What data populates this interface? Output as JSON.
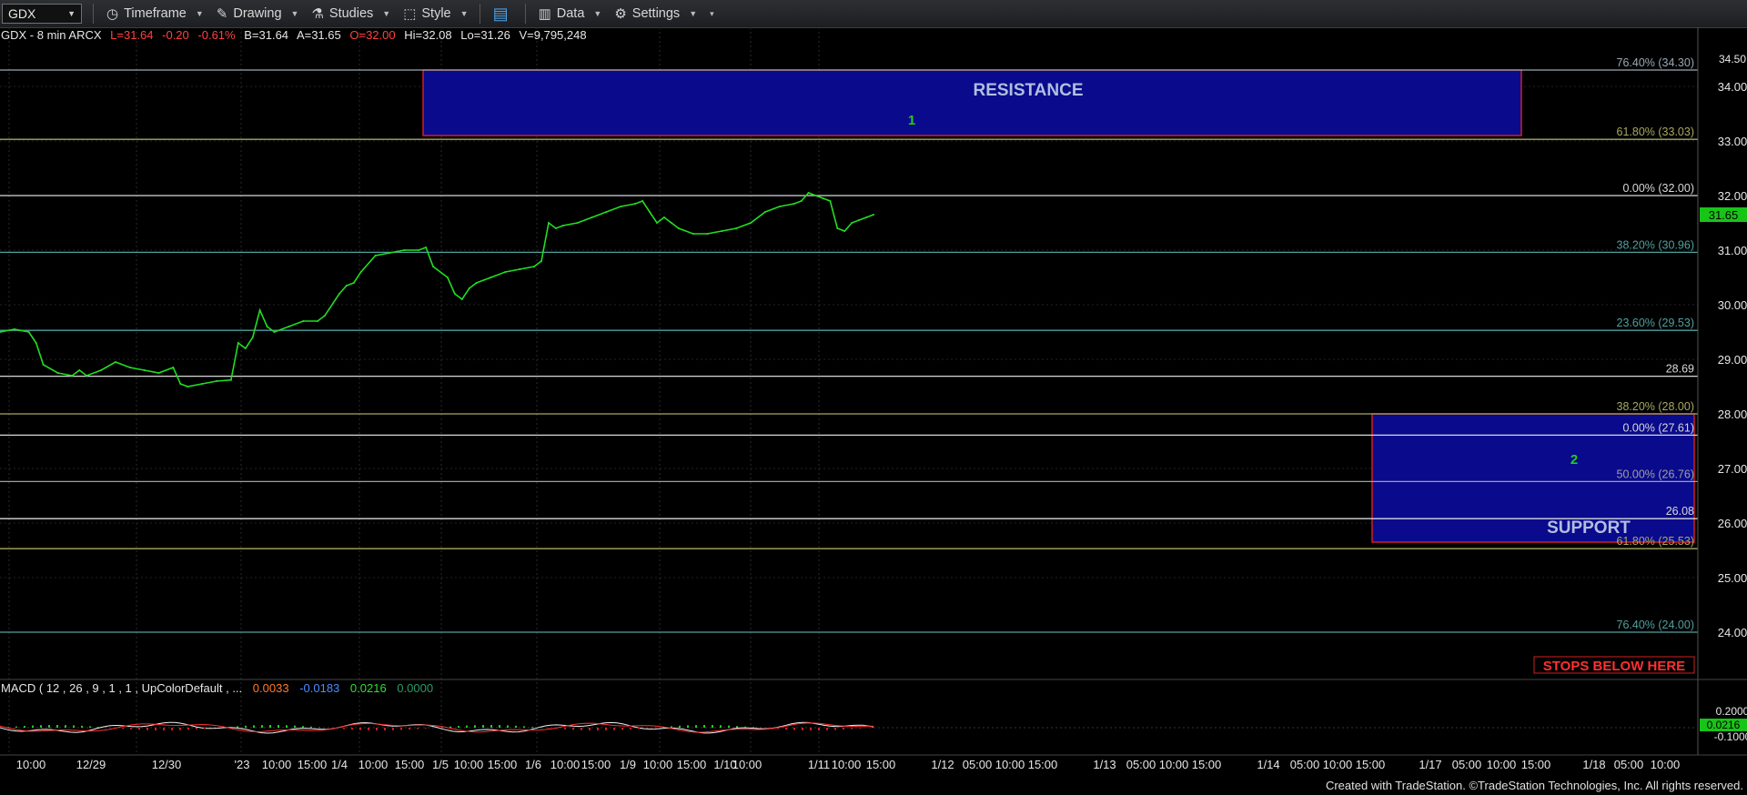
{
  "toolbar": {
    "symbol": "GDX",
    "timeframe": "Timeframe",
    "drawing": "Drawing",
    "studies": "Studies",
    "style": "Style",
    "data": "Data",
    "settings": "Settings"
  },
  "header": {
    "symbol": "GDX - 8 min  ARCX",
    "last": "L=31.64",
    "change": "-0.20",
    "pct": "-0.61%",
    "bid": "B=31.64",
    "ask": "A=31.65",
    "open": "O=32.00",
    "high": "Hi=32.08",
    "low": "Lo=31.26",
    "volume": "V=9,795,248"
  },
  "macd_header": {
    "label": "MACD ( 12 , 26 , 9 , 1 , 1 , UpColorDefault , ...",
    "v1": "0.0033",
    "v2": "-0.0183",
    "v3": "0.0216",
    "v4": "0.0000"
  },
  "chart_data": {
    "type": "line",
    "title": "",
    "ylim": [
      23.0,
      35.0
    ],
    "y_ticks": [
      "34.00",
      "33.00",
      "32.00",
      "31.00",
      "30.00",
      "29.00",
      "28.00",
      "27.00",
      "26.00",
      "25.00",
      "24.00"
    ],
    "current_price_tag": "31.65",
    "x_tick_labels": [
      "10:00",
      "12/29",
      "12/30",
      "'23",
      "10:00",
      "15:00",
      "1/4",
      "10:00",
      "15:00",
      "1/5",
      "10:00",
      "15:00",
      "1/6",
      "10:00",
      "15:00",
      "1/9",
      "10:00",
      "15:00",
      "1/10",
      "10:00",
      "1/11",
      "10:00",
      "15:00",
      "1/12",
      "05:00",
      "10:00",
      "15:00",
      "1/13",
      "05:00",
      "10:00",
      "15:00",
      "1/14",
      "05:00",
      "10:00",
      "15:00",
      "1/17",
      "05:00",
      "10:00",
      "15:00",
      "1/18",
      "05:00",
      "10:00"
    ],
    "series": [
      {
        "color": "#22dd22",
        "points": [
          [
            0,
            29.5
          ],
          [
            2,
            29.55
          ],
          [
            4,
            29.5
          ],
          [
            5,
            29.3
          ],
          [
            6,
            28.9
          ],
          [
            8,
            28.75
          ],
          [
            10,
            28.7
          ],
          [
            11,
            28.8
          ],
          [
            12,
            28.7
          ],
          [
            14,
            28.8
          ],
          [
            16,
            28.95
          ],
          [
            18,
            28.85
          ],
          [
            20,
            28.8
          ],
          [
            22,
            28.75
          ],
          [
            24,
            28.85
          ],
          [
            25,
            28.55
          ],
          [
            26,
            28.5
          ],
          [
            28,
            28.55
          ],
          [
            30,
            28.6
          ],
          [
            32,
            28.62
          ],
          [
            33,
            29.3
          ],
          [
            34,
            29.2
          ],
          [
            35,
            29.4
          ],
          [
            36,
            29.9
          ],
          [
            37,
            29.6
          ],
          [
            38,
            29.5
          ],
          [
            40,
            29.6
          ],
          [
            42,
            29.7
          ],
          [
            44,
            29.7
          ],
          [
            45,
            29.8
          ],
          [
            47,
            30.2
          ],
          [
            48,
            30.35
          ],
          [
            49,
            30.4
          ],
          [
            50,
            30.6
          ],
          [
            52,
            30.9
          ],
          [
            54,
            30.95
          ],
          [
            56,
            31.0
          ],
          [
            58,
            31.0
          ],
          [
            59,
            31.05
          ],
          [
            60,
            30.7
          ],
          [
            62,
            30.5
          ],
          [
            63,
            30.2
          ],
          [
            64,
            30.1
          ],
          [
            65,
            30.3
          ],
          [
            66,
            30.4
          ],
          [
            68,
            30.5
          ],
          [
            70,
            30.6
          ],
          [
            72,
            30.65
          ],
          [
            74,
            30.7
          ],
          [
            75,
            30.8
          ],
          [
            76,
            31.5
          ],
          [
            77,
            31.4
          ],
          [
            78,
            31.45
          ],
          [
            80,
            31.5
          ],
          [
            82,
            31.6
          ],
          [
            84,
            31.7
          ],
          [
            86,
            31.8
          ],
          [
            88,
            31.85
          ],
          [
            89,
            31.9
          ],
          [
            90,
            31.7
          ],
          [
            91,
            31.5
          ],
          [
            92,
            31.6
          ],
          [
            93,
            31.5
          ],
          [
            94,
            31.4
          ],
          [
            96,
            31.3
          ],
          [
            98,
            31.3
          ],
          [
            100,
            31.35
          ],
          [
            102,
            31.4
          ],
          [
            104,
            31.5
          ],
          [
            106,
            31.7
          ],
          [
            108,
            31.8
          ],
          [
            110,
            31.85
          ],
          [
            111,
            31.9
          ],
          [
            112,
            32.05
          ],
          [
            113,
            32.0
          ],
          [
            114,
            31.95
          ],
          [
            115,
            31.9
          ],
          [
            116,
            31.4
          ],
          [
            117,
            31.35
          ],
          [
            118,
            31.5
          ],
          [
            119,
            31.55
          ],
          [
            120,
            31.6
          ],
          [
            121,
            31.65
          ]
        ]
      }
    ],
    "horizontal_levels": [
      {
        "value": 34.3,
        "label": "76.40% (34.30)",
        "color": "#9aa8b5"
      },
      {
        "value": 33.03,
        "label": "61.80% (33.03)",
        "color": "#a8a860"
      },
      {
        "value": 32.0,
        "label": "0.00% (32.00)",
        "color": "#d8d8d8"
      },
      {
        "value": 30.96,
        "label": "38.20% (30.96)",
        "color": "#4fa0a0"
      },
      {
        "value": 29.53,
        "label": "23.60% (29.53)",
        "color": "#4fa0a0"
      },
      {
        "value": 28.69,
        "label": "28.69",
        "color": "#d8d8d8"
      },
      {
        "value": 28.0,
        "label": "38.20% (28.00)",
        "color": "#a8a860"
      },
      {
        "value": 27.61,
        "label": "0.00% (27.61)",
        "color": "#d8d8d8"
      },
      {
        "value": 26.76,
        "label": "50.00% (26.76)",
        "color": "#a0a0a0"
      },
      {
        "value": 26.08,
        "label": "26.08",
        "color": "#d8d8d8"
      },
      {
        "value": 25.53,
        "label": "61.80% (25.53)",
        "color": "#a8a860"
      },
      {
        "value": 24.0,
        "label": "76.40% (24.00)",
        "color": "#4fa0a0"
      }
    ],
    "zones": [
      {
        "label": "RESISTANCE",
        "marker": "1",
        "y_top": 34.3,
        "y_bottom": 33.1
      },
      {
        "label": "SUPPORT",
        "marker": "2",
        "y_top": 28.0,
        "y_bottom": 25.65
      }
    ],
    "stops_label": "STOPS BELOW HERE",
    "macd_ticks": [
      "0.2000",
      "-0.1000"
    ],
    "macd_current_tag": "0.0216",
    "top_partial_tick": "34.50"
  },
  "footer": {
    "credit": "Created with TradeStation. ©TradeStation Technologies, Inc. All rights reserved."
  },
  "colors": {
    "price_line": "#22dd22",
    "zone_fill": "#0a0a8c",
    "zone_border": "#d02020",
    "zone_label": "#aebfe0",
    "marker": "#22cc22",
    "axis_text": "#e6e6e6",
    "header_red": "#ff4040",
    "stops_text": "#ff3030"
  }
}
